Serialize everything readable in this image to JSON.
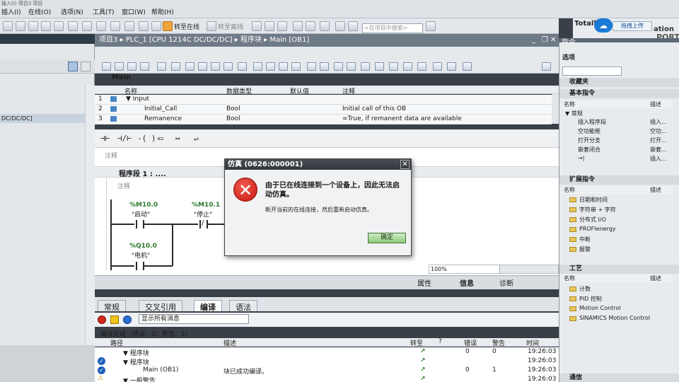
{
  "window": {
    "title_fragment": "插入(I)  项目3  项目"
  },
  "menu": [
    "插入(I)",
    "在线(O)",
    "选项(N)",
    "工具(T)",
    "窗口(W)",
    "帮助(H)"
  ],
  "toolbar": {
    "go_online": "转至在线",
    "go_offline": "转至离线",
    "search_placeholder": "<在项目中搜索>"
  },
  "brand": {
    "prefix": "Totall",
    "upload_label": "拖拽上传",
    "line1": "ation",
    "line2": "PORTAL"
  },
  "left_tree": {
    "selected_item": "DC/DC/DC]"
  },
  "editor": {
    "breadcrumb": "项目3 ▸ PLC_1 [CPU 1214C DC/DC/DC] ▸ 程序块 ▸ Main [OB1]",
    "block_name": "Main",
    "interface": {
      "columns": [
        "名称",
        "数据类型",
        "默认值",
        "注释"
      ],
      "rows": [
        {
          "num": "1",
          "name": "▼ Input",
          "type": "",
          "default": "",
          "comment": ""
        },
        {
          "num": "2",
          "name": "Initial_Call",
          "type": "Bool",
          "default": "",
          "comment": "Initial call of this OB"
        },
        {
          "num": "3",
          "name": "Remanence",
          "type": "Bool",
          "default": "",
          "comment": "=True, if remanent data are available"
        }
      ]
    },
    "ladder_symbols": [
      "⊣⊢",
      "⊣/⊢",
      "-( )-",
      "▭",
      "↦",
      "↵"
    ],
    "block_comment": "注释",
    "network_title": "程序段 1 :  ....",
    "network_comment": "注释",
    "contacts": [
      {
        "address": "%M10.0",
        "symbol": "\"启动\""
      },
      {
        "address": "%M10.1",
        "symbol": "\"停止\""
      },
      {
        "address": "%Q10.0",
        "symbol": "\"电机\""
      }
    ],
    "zoom": "100%"
  },
  "dialog": {
    "title": "仿真 (0626:000001)",
    "message": "由于已在线连接到一个设备上，因此无法启动仿真。",
    "detail": "断开当前的在线连接，然后重新启动仿真。",
    "ok_label": "确定"
  },
  "inspector": {
    "tabs_right": [
      "属性",
      "信息",
      "诊断"
    ],
    "tabs": [
      "常规",
      "交叉引用",
      "编译",
      "语法"
    ],
    "active_tab": "编译",
    "filter": "显示所有消息",
    "summary": "编译完成（错误：0；警告：1）",
    "columns": [
      "路径",
      "描述",
      "转至",
      "?",
      "错误",
      "警告",
      "时间"
    ],
    "rows": [
      {
        "path": "▼ 程序块",
        "desc": "",
        "goto": "↗",
        "errors": "0",
        "warnings": "0",
        "time": "19:26:03"
      },
      {
        "path": "▼ 程序块",
        "desc": "",
        "goto": "↗",
        "errors": "",
        "warnings": "",
        "time": "19:26:03"
      },
      {
        "path": "Main (OB1)",
        "desc": "块已成功编译。",
        "goto": "↗",
        "errors": "0",
        "warnings": "1",
        "time": "19:26:03"
      },
      {
        "path": "▼ 一般警告",
        "desc": "",
        "goto": "↗",
        "errors": "",
        "warnings": "",
        "time": "19:26:03"
      }
    ]
  },
  "right_pane": {
    "title": "指令",
    "options": "选项",
    "favorites": "收藏夹",
    "basic": "基本指令",
    "ext": "扩展指令",
    "tech": "工艺",
    "comm": "通信",
    "col_name": "名称",
    "col_desc": "描述",
    "basic_items": [
      {
        "name": "▼ 常规",
        "desc": ""
      },
      {
        "name": "插入程序段",
        "desc": "插入..."
      },
      {
        "name": "空功能框",
        "desc": "空功..."
      },
      {
        "name": "打开分支",
        "desc": "打开..."
      },
      {
        "name": "嵌套闭合",
        "desc": "嵌套..."
      },
      {
        "name": "→|",
        "desc": "插入..."
      }
    ],
    "ext_items": [
      "日期和时间",
      "字符串 + 字符",
      "分布式 I/O",
      "PROFIenergy",
      "中断",
      "报警"
    ],
    "tech_items": [
      "计数",
      "PID 控制",
      "Motion Control",
      "SINAMICS Motion Control"
    ]
  }
}
